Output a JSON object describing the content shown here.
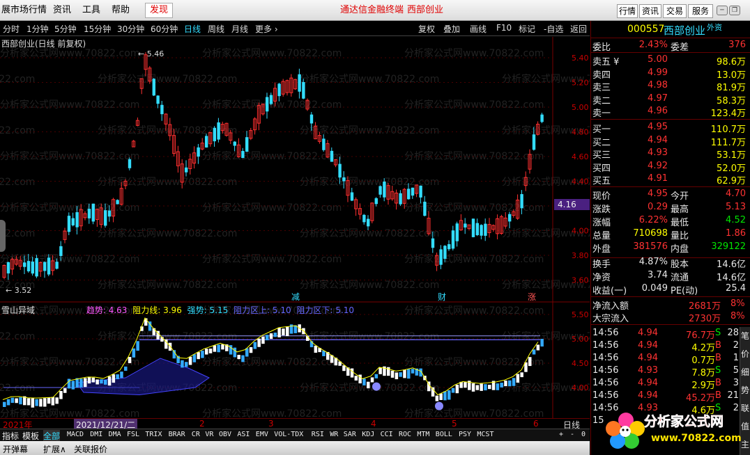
{
  "menu": [
    "展市场行情",
    "资讯",
    "工具",
    "帮助"
  ],
  "menu_highlight": "发现",
  "brand": [
    "通达信金融终端",
    "西部创业"
  ],
  "top_buttons": [
    "行情",
    "资讯",
    "交易",
    "服务"
  ],
  "periods": [
    "分时",
    "1分钟",
    "5分钟",
    "15分钟",
    "30分钟",
    "60分钟",
    "日线",
    "周线",
    "月线",
    "更多 ›"
  ],
  "active_period": "日线",
  "tools": [
    "复权",
    "叠加",
    "画线",
    "F10",
    "标记",
    "-自选",
    "返回"
  ],
  "main_title": "西部创业(日线 前复权)",
  "price_labels": [
    "5.40",
    "5.20",
    "5.00",
    "4.80",
    "4.60",
    "4.40",
    "4.20",
    "4.00",
    "3.80",
    "3.60"
  ],
  "current_price_tag": "4.16",
  "high_label": "5.46",
  "low_label": "3.52",
  "event_markers": [
    "减",
    "财",
    "涨"
  ],
  "sub_indicator": {
    "name": "雪山异域",
    "trend": "趋势: 4.63",
    "resist": "阻力线: 3.96",
    "strong": "强势: 5.15",
    "upper": "阻力区上: 5.10",
    "lower": "阻力区下: 5.10"
  },
  "sub_price_labels": [
    "5.50",
    "5.00",
    "4.50",
    "4.00"
  ],
  "x_axis": [
    "2021年",
    "2021/12/21/二",
    "2",
    "3",
    "4",
    "5",
    "6"
  ],
  "period_label": "日线",
  "indicators": [
    "全部",
    "MACD",
    "DMI",
    "DMA",
    "FSL",
    "TRIX",
    "BRAR",
    "CR",
    "VR",
    "OBV",
    "ASI",
    "EMV",
    "VOL-TDX",
    "RSI",
    "WR",
    "SAR",
    "KDJ",
    "CCI",
    "ROC",
    "MTM",
    "BOLL",
    "PSY",
    "MCST"
  ],
  "idx_left": [
    "指标",
    "模板"
  ],
  "bottom_tabs": [
    "开弹幕",
    "扩展∧",
    "关联报价"
  ],
  "bottom_controls": [
    "+",
    "-",
    "0"
  ],
  "stock": {
    "code": "000557",
    "name": "西部创业",
    "tag": "外资"
  },
  "weibi": {
    "label": "委比",
    "value": "2.43%",
    "label2": "委差",
    "value2": "376"
  },
  "asks": [
    {
      "label": "卖五 ¥",
      "price": "5.00",
      "vol": "98.6万"
    },
    {
      "label": "卖四",
      "price": "4.99",
      "vol": "13.0万"
    },
    {
      "label": "卖三",
      "price": "4.98",
      "vol": "81.9万"
    },
    {
      "label": "卖二",
      "price": "4.97",
      "vol": "58.3万"
    },
    {
      "label": "卖一",
      "price": "4.96",
      "vol": "123.4万"
    }
  ],
  "bids": [
    {
      "label": "买一",
      "price": "4.95",
      "vol": "110.7万"
    },
    {
      "label": "买二",
      "price": "4.94",
      "vol": "111.7万"
    },
    {
      "label": "买三",
      "price": "4.93",
      "vol": "53.1万"
    },
    {
      "label": "买四",
      "price": "4.92",
      "vol": "52.0万"
    },
    {
      "label": "买五",
      "price": "4.91",
      "vol": "62.9万"
    }
  ],
  "quote": [
    {
      "l1": "现价",
      "v1": "4.95",
      "c1": "red",
      "l2": "今开",
      "v2": "4.70",
      "c2": "red"
    },
    {
      "l1": "涨跌",
      "v1": "0.29",
      "c1": "red",
      "l2": "最高",
      "v2": "5.13",
      "c2": "red"
    },
    {
      "l1": "涨幅",
      "v1": "6.22%",
      "c1": "red",
      "l2": "最低",
      "v2": "4.52",
      "c2": "grn"
    },
    {
      "l1": "总量",
      "v1": "710698",
      "c1": "yel",
      "l2": "量比",
      "v2": "1.86",
      "c2": "red"
    },
    {
      "l1": "外盘",
      "v1": "381576",
      "c1": "red",
      "l2": "内盘",
      "v2": "329122",
      "c2": "grn"
    }
  ],
  "fundamentals": [
    {
      "l1": "换手",
      "v1": "4.87%",
      "l2": "股本",
      "v2": "14.6亿"
    },
    {
      "l1": "净资",
      "v1": "3.74",
      "l2": "流通",
      "v2": "14.6亿"
    },
    {
      "l1": "收益(一)",
      "v1": "0.049",
      "l2": "PE(动)",
      "v2": "25.4"
    }
  ],
  "flows": [
    {
      "label": "净流入额",
      "value": "2681万",
      "pct": "8%"
    },
    {
      "label": "大宗流入",
      "value": "2730万",
      "pct": "8%"
    }
  ],
  "ticks": [
    {
      "time": "14:56",
      "price": "4.94",
      "vol": "76.7万",
      "side": "S",
      "num": "28",
      "vc": "red"
    },
    {
      "time": "14:56",
      "price": "4.94",
      "vol": "4.2万",
      "side": "B",
      "num": "2",
      "vc": "yel"
    },
    {
      "time": "14:56",
      "price": "4.94",
      "vol": "0.7万",
      "side": "B",
      "num": "1",
      "vc": "yel"
    },
    {
      "time": "14:56",
      "price": "4.93",
      "vol": "7.8万",
      "side": "S",
      "num": "5",
      "vc": "yel"
    },
    {
      "time": "14:56",
      "price": "4.94",
      "vol": "2.9万",
      "side": "B",
      "num": "3",
      "vc": "yel"
    },
    {
      "time": "14:56",
      "price": "4.94",
      "vol": "45.2万",
      "side": "B",
      "num": "21",
      "vc": "red"
    },
    {
      "time": "14:56",
      "price": "4.93",
      "vol": "4.6万",
      "side": "S",
      "num": "2",
      "vc": "yel"
    },
    {
      "time": "15",
      "price": "",
      "vol": "",
      "side": "",
      "num": "",
      "vc": "yel"
    }
  ],
  "side_tabs": [
    "笔",
    "价",
    "细",
    "势",
    "联",
    "值",
    "主"
  ],
  "logo": {
    "text": "分析家公式网",
    "url": "www.70822.com"
  },
  "watermark": "分析家公式网www.70822.com"
}
